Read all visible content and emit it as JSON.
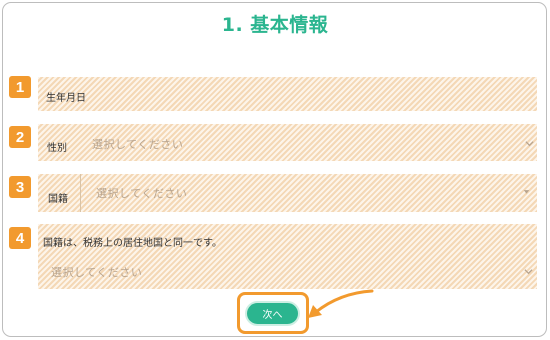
{
  "title": "1. 基本情報",
  "steps": {
    "s1": "1",
    "s2": "2",
    "s3": "3",
    "s4": "4"
  },
  "fields": {
    "birthdate_label": "生年月日",
    "gender_label": "性別",
    "gender_placeholder": "選択してください",
    "nationality_label": "国籍",
    "nationality_placeholder": "選択してください",
    "residence_note": "国籍は、税務上の居住地国と同一です。",
    "residence_placeholder": "選択してください"
  },
  "next_button_label": "次へ",
  "colors": {
    "title": "#2bb58f",
    "badge": "#f29a2e",
    "button": "#2bb58f",
    "highlight": "#f29a2e"
  }
}
